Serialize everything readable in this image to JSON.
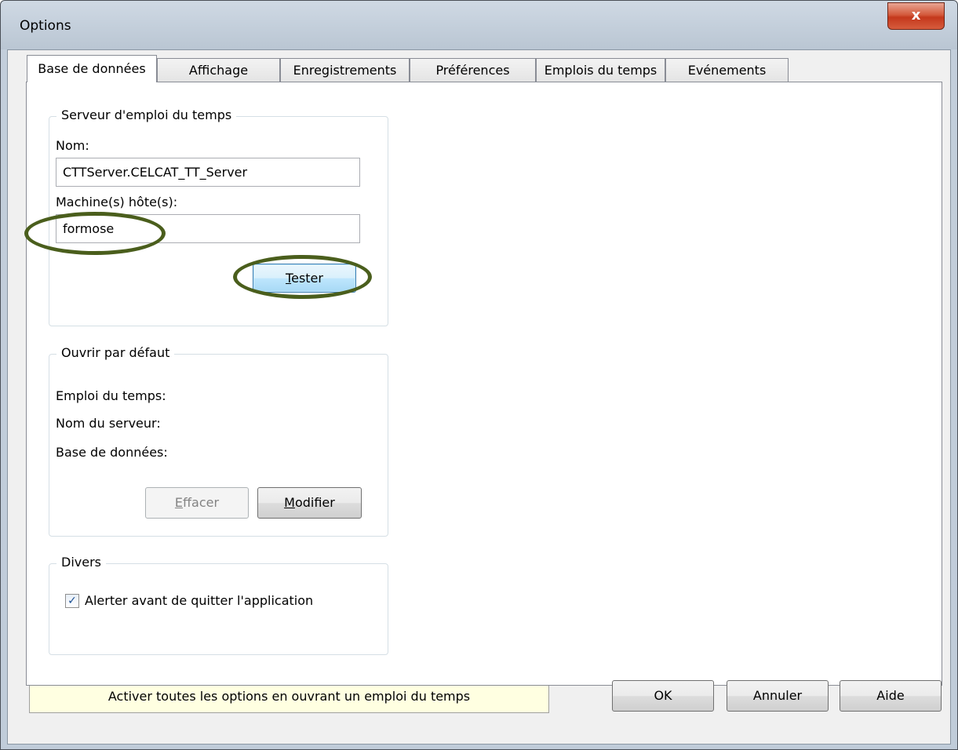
{
  "window": {
    "title": "Options",
    "close_label": "x"
  },
  "tabs": [
    {
      "label": "Base de données"
    },
    {
      "label": "Affichage"
    },
    {
      "label": "Enregistrements"
    },
    {
      "label": "Préférences"
    },
    {
      "label": "Emplois du temps"
    },
    {
      "label": "Evénements"
    }
  ],
  "server_group": {
    "legend": "Serveur d'emploi du temps",
    "name_label": "Nom:",
    "name_value": "CTTServer.CELCAT_TT_Server",
    "host_label": "Machine(s) hôte(s):",
    "host_value": "formose",
    "test_button": {
      "mnemonic": "T",
      "rest": "ester"
    }
  },
  "default_group": {
    "legend": "Ouvrir par défaut",
    "timetable_label": "Emploi du temps:",
    "server_name_label": "Nom du serveur:",
    "database_label": "Base de données:",
    "clear_button": {
      "mnemonic": "E",
      "rest": "ffacer"
    },
    "modify_button": {
      "mnemonic": "M",
      "rest": "odifier"
    }
  },
  "misc_group": {
    "legend": "Divers",
    "alert_checkbox_label": "Alerter avant de quitter l'application",
    "alert_checked": true
  },
  "footer": {
    "status_text": "Activer toutes les options en ouvrant un emploi du temps",
    "ok_label": "OK",
    "cancel_label": "Annuler",
    "help_label": "Aide"
  },
  "colors": {
    "annotation_ellipse": "#4a5e1c",
    "status_background": "#ffffe1"
  }
}
